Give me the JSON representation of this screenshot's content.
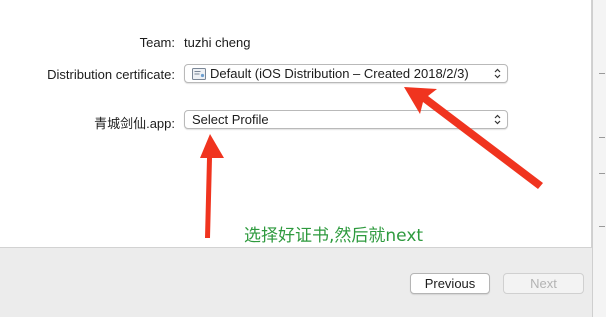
{
  "form": {
    "team_label": "Team:",
    "team_value": "tuzhi cheng",
    "cert_label": "Distribution certificate:",
    "cert_value": "Default (iOS Distribution – Created 2018/2/3)",
    "app_label": "青城剑仙.app:",
    "profile_value": "Select Profile"
  },
  "annotation": {
    "text": "选择好证书,然后就next",
    "arrow_color": "#f0341f",
    "text_color": "#2e9a3e"
  },
  "footer": {
    "previous_label": "Previous",
    "next_label": "Next"
  },
  "icons": {
    "cert": "certificate-icon",
    "chevron": "updown-chevron-icon"
  }
}
